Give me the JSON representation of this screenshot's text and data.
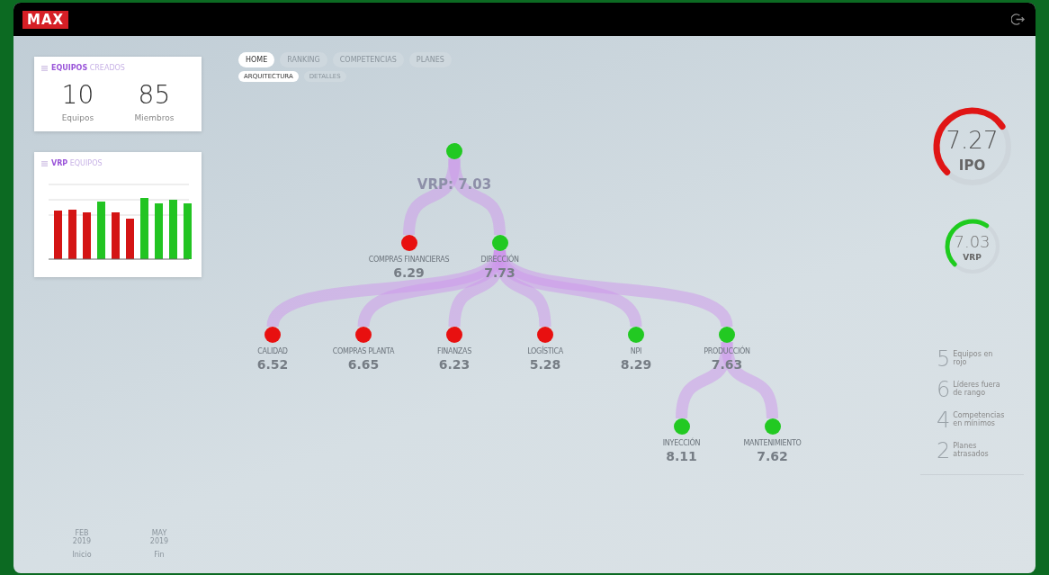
{
  "header": {
    "logo": "MAX"
  },
  "cards": [
    {
      "title": "**EQUIPOS** CREADOS",
      "stats": [
        {
          "value": "10",
          "label": "Equipos"
        },
        {
          "value": "85",
          "label": "Miembros"
        }
      ]
    },
    {
      "title": "**VRP** EQUIPOS"
    }
  ],
  "tabs": [
    {
      "label": "HOME",
      "selected": true
    },
    {
      "label": "RANKING",
      "selected": false
    },
    {
      "label": "COMPETENCIAS",
      "selected": false
    },
    {
      "label": "PLANES",
      "selected": false
    }
  ],
  "subtabs": [
    {
      "label": "ARQUITECTURA",
      "selected": true
    },
    {
      "label": "DETALLES",
      "selected": false
    }
  ],
  "tree": {
    "label": "VRP: 7.03",
    "color": "#22c922",
    "children": [
      {
        "name": "COMPRAS FINANCIERAS",
        "score": "6.29",
        "color": "#e81010"
      },
      {
        "name": "DIRECCIÓN",
        "score": "7.73",
        "color": "#22c922",
        "children": [
          {
            "name": "CALIDAD",
            "score": "6.52",
            "color": "#e81010"
          },
          {
            "name": "COMPRAS PLANTA",
            "score": "6.65",
            "color": "#e81010"
          },
          {
            "name": "FINANZAS",
            "score": "6.23",
            "color": "#e81010"
          },
          {
            "name": "LOGÍSTICA",
            "score": "5.28",
            "color": "#e81010"
          },
          {
            "name": "NPI",
            "score": "8.29",
            "color": "#22c922"
          },
          {
            "name": "PRODUCCIÓN",
            "score": "7.63",
            "color": "#22c922",
            "children": [
              {
                "name": "INYECCIÓN",
                "score": "8.11",
                "color": "#22c922"
              },
              {
                "name": "MANTENIMIENTO",
                "score": "7.62",
                "color": "#22c922"
              }
            ]
          }
        ]
      }
    ]
  },
  "gauges": [
    {
      "value": "7.27",
      "label": "IPO",
      "color": "#e01515"
    },
    {
      "value": "7.03",
      "label": "VRP",
      "color": "#1ecb1e"
    }
  ],
  "summary": [
    {
      "value": "5",
      "label": "Equipos en rojo"
    },
    {
      "value": "6",
      "label": "Líderes fuera de rango"
    },
    {
      "value": "4",
      "label": "Competencias en mínimos"
    },
    {
      "value": "2",
      "label": "Planes atrasados"
    }
  ],
  "dates": [
    {
      "date": "FEB 2019",
      "label": "Inicio"
    },
    {
      "date": "MAY 2019",
      "label": "Fin"
    }
  ]
}
